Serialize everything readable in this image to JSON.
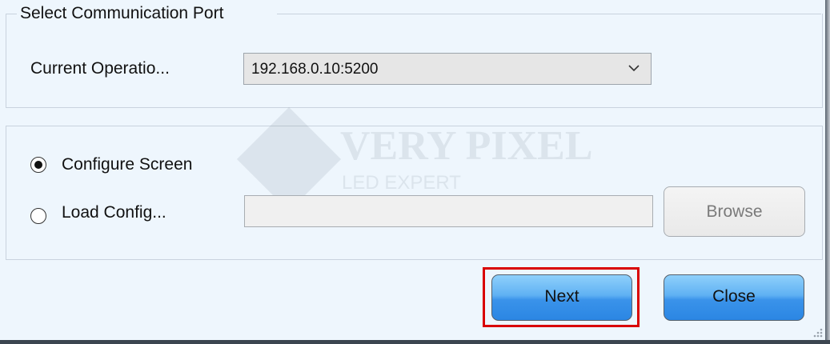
{
  "communication_port": {
    "legend": "Select Communication Port",
    "current_operation_label": "Current Operatio...",
    "current_operation_value": "192.168.0.10:5200"
  },
  "configuration": {
    "configure_screen_label": "Configure Screen",
    "configure_screen_selected": true,
    "load_config_label": "Load Config...",
    "load_config_selected": false,
    "load_config_path": "",
    "browse_label": "Browse"
  },
  "buttons": {
    "next_label": "Next",
    "close_label": "Close"
  },
  "watermark": {
    "brand": "VERY PIXEL",
    "subtitle": "LED EXPERT"
  },
  "highlight_color": "#d90000"
}
